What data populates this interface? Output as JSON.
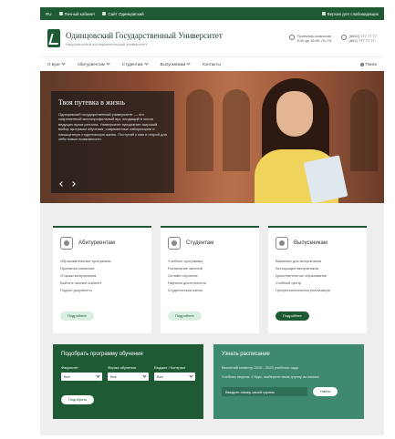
{
  "topbar": {
    "lang": "RU",
    "personal": "Личный кабинет",
    "site": "Сайт Одинцовский",
    "accessible": "Версия для слабовидящих"
  },
  "header": {
    "title": "Одинцовский Государственный Университет",
    "subtitle": "Национальный исследовательский университет",
    "reception_label": "Приемная комиссия",
    "reception_hours": "9:00 до 18:00, Пн-Пт",
    "phone1": "(8652) 777 77 77",
    "phone2": "(862) 777 77 77"
  },
  "nav": {
    "items": [
      "О вузе",
      "Абитуриентам",
      "Студентам",
      "Выпускникам",
      "Контакты"
    ],
    "search": "Поиск"
  },
  "hero": {
    "title": "Твоя путевка в жизнь",
    "text": "Одинцовский государственный университет — это современный многопрофильный вуз, входящий в число ведущих вузов региона. Университет предлагает широкий выбор программ обучения, современные лаборатории и насыщенную студенческую жизнь. Поступай к нам и открой для себя новые возможности."
  },
  "cards": [
    {
      "title": "Абитуриентам",
      "links": [
        "Образовательные программы",
        "Приемная комиссия",
        "Отзывы выпускников",
        "Войти в личный кабинет",
        "Подать документы"
      ],
      "button": "Подробнее"
    },
    {
      "title": "Студентам",
      "links": [
        "Учебные программы",
        "Расписание занятий",
        "Онлайн обучение",
        "Научная деятельность",
        "Студенческая жизнь"
      ],
      "button": "Подробнее"
    },
    {
      "title": "Выпускникам",
      "links": [
        "Вакансии для выпускников",
        "Ассоциация выпускников",
        "Дополнительное образование",
        "Учебный центр",
        "Профессиональная реализация"
      ],
      "button": "Подробнее"
    }
  ],
  "program": {
    "title": "Подобрать программу обучения",
    "labels": [
      "Факультет",
      "Форма обучения",
      "Бюджет / Контракт"
    ],
    "values": [
      "Все",
      "Все",
      "Все"
    ],
    "button": "Подобрать"
  },
  "schedule": {
    "title": "Узнать расписание",
    "line1": "Весенний семестр 2019 - 2020 учебного года",
    "line2": "Учебная неделя: 2 Курс, выберите свою группу из списка",
    "input_placeholder": "Введите номер своей группы",
    "button": "Найти"
  },
  "colors": {
    "brand": "#1e5a33",
    "accent": "#3f8a6e"
  }
}
